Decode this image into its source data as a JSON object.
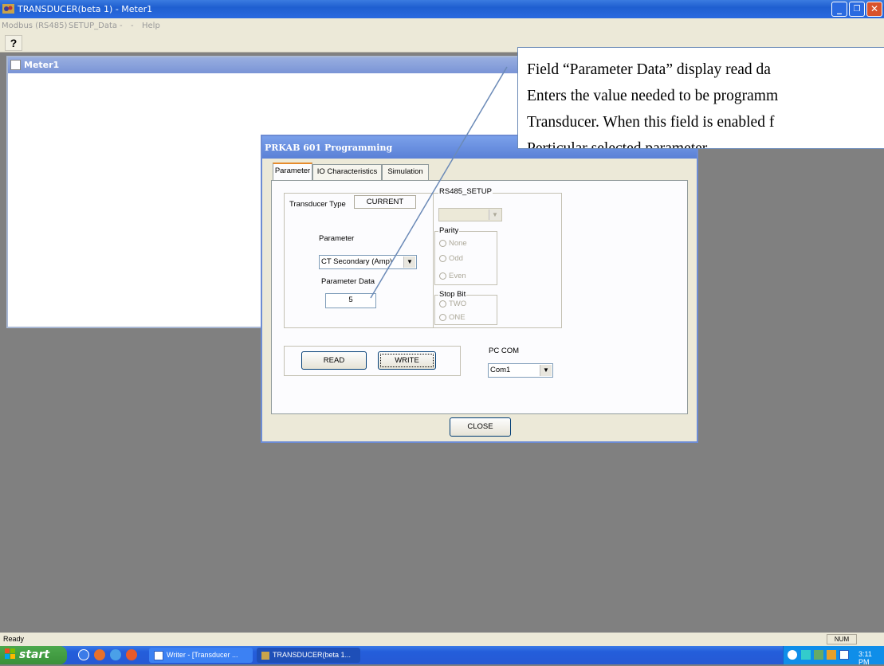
{
  "window": {
    "title": "TRANSDUCER(beta 1) - Meter1",
    "menu": [
      "Modbus (RS485)",
      "SETUP_Data",
      "-",
      "-",
      "Help"
    ],
    "toolbar_help": "?"
  },
  "mdi_child": {
    "title": "Meter1"
  },
  "dialog": {
    "title": "PRKAB 601 Programming",
    "tabs": [
      "Parameter",
      "IO Characteristics",
      "Simulation"
    ],
    "transducer_type_label": "Transducer Type",
    "transducer_type_value": "CURRENT",
    "parameter_label": "Parameter",
    "parameter_value": "CT Secondary (Amp)",
    "parameter_data_label": "Parameter Data",
    "parameter_data_value": "5",
    "rs485_title": "RS485_SETUP",
    "parity_label": "Parity",
    "parity_options": [
      "None",
      "Odd",
      "Even"
    ],
    "stopbit_label": "Stop Bit",
    "stopbit_options": [
      "TWO",
      "ONE"
    ],
    "read_label": "READ",
    "write_label": "WRITE",
    "pc_com_label": "PC COM",
    "pc_com_value": "Com1",
    "close_label": "CLOSE"
  },
  "callout": {
    "lines": [
      "Field “Parameter Data” display read da",
      "Enters the value needed to be programm",
      "Transducer. When this field is enabled f",
      "Perticular selected parameter."
    ]
  },
  "statusbar": {
    "text": "Ready",
    "num": "NUM"
  },
  "taskbar": {
    "start": "start",
    "task1": "Writer - [Transducer ...",
    "task2": "TRANSDUCER(beta 1...",
    "clock": "3:11 PM"
  },
  "colors": {
    "desktop": "#808080",
    "titlebar": "#2a6ae0",
    "callout_line": "#6b8ab7"
  }
}
